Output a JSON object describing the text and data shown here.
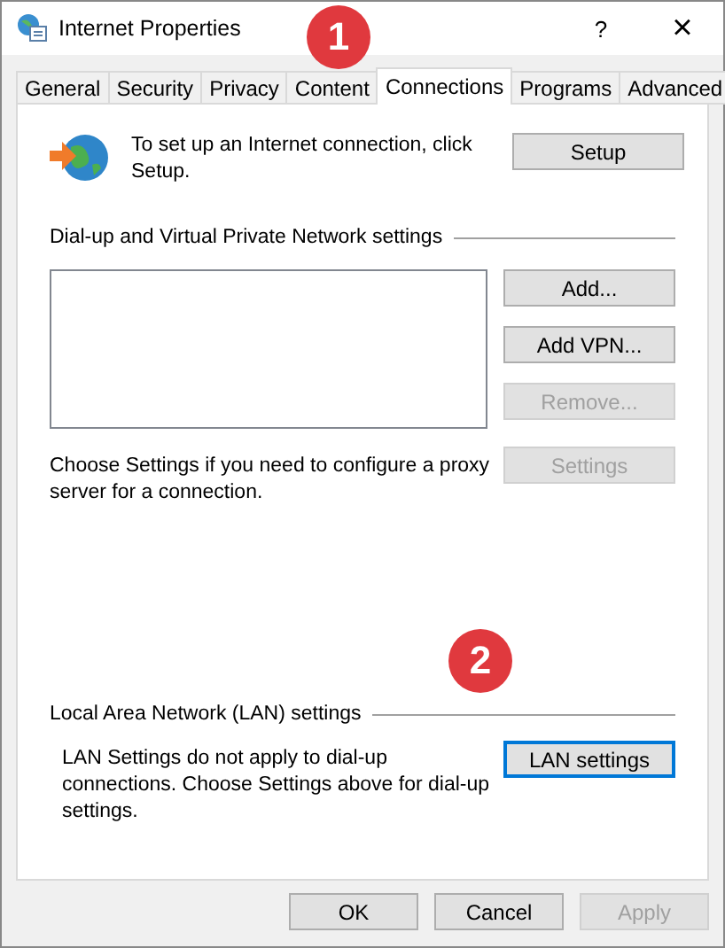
{
  "window": {
    "title": "Internet Properties",
    "help": "?",
    "close": "×"
  },
  "tabs": [
    {
      "label": "General",
      "selected": false
    },
    {
      "label": "Security",
      "selected": false
    },
    {
      "label": "Privacy",
      "selected": false
    },
    {
      "label": "Content",
      "selected": false
    },
    {
      "label": "Connections",
      "selected": true
    },
    {
      "label": "Programs",
      "selected": false
    },
    {
      "label": "Advanced",
      "selected": false
    }
  ],
  "setup": {
    "text": "To set up an Internet connection, click Setup.",
    "button": {
      "label": "Setup",
      "disabled": false
    }
  },
  "dialup": {
    "heading": "Dial-up and Virtual Private Network settings",
    "buttons": [
      {
        "label": "Add...",
        "disabled": false
      },
      {
        "label": "Add VPN...",
        "disabled": false
      },
      {
        "label": "Remove...",
        "disabled": true
      }
    ],
    "proxy_text": "Choose Settings if you need to configure a proxy server for a connection.",
    "settings_button": {
      "label": "Settings",
      "disabled": true
    }
  },
  "lan": {
    "heading": "Local Area Network (LAN) settings",
    "text": "LAN Settings do not apply to dial-up connections. Choose Settings above for dial-up settings.",
    "button": {
      "label": "LAN settings",
      "disabled": false,
      "focused": true
    }
  },
  "callouts": [
    "1",
    "2"
  ],
  "footer_buttons": [
    {
      "label": "OK",
      "disabled": false
    },
    {
      "label": "Cancel",
      "disabled": false
    },
    {
      "label": "Apply",
      "disabled": true
    }
  ]
}
